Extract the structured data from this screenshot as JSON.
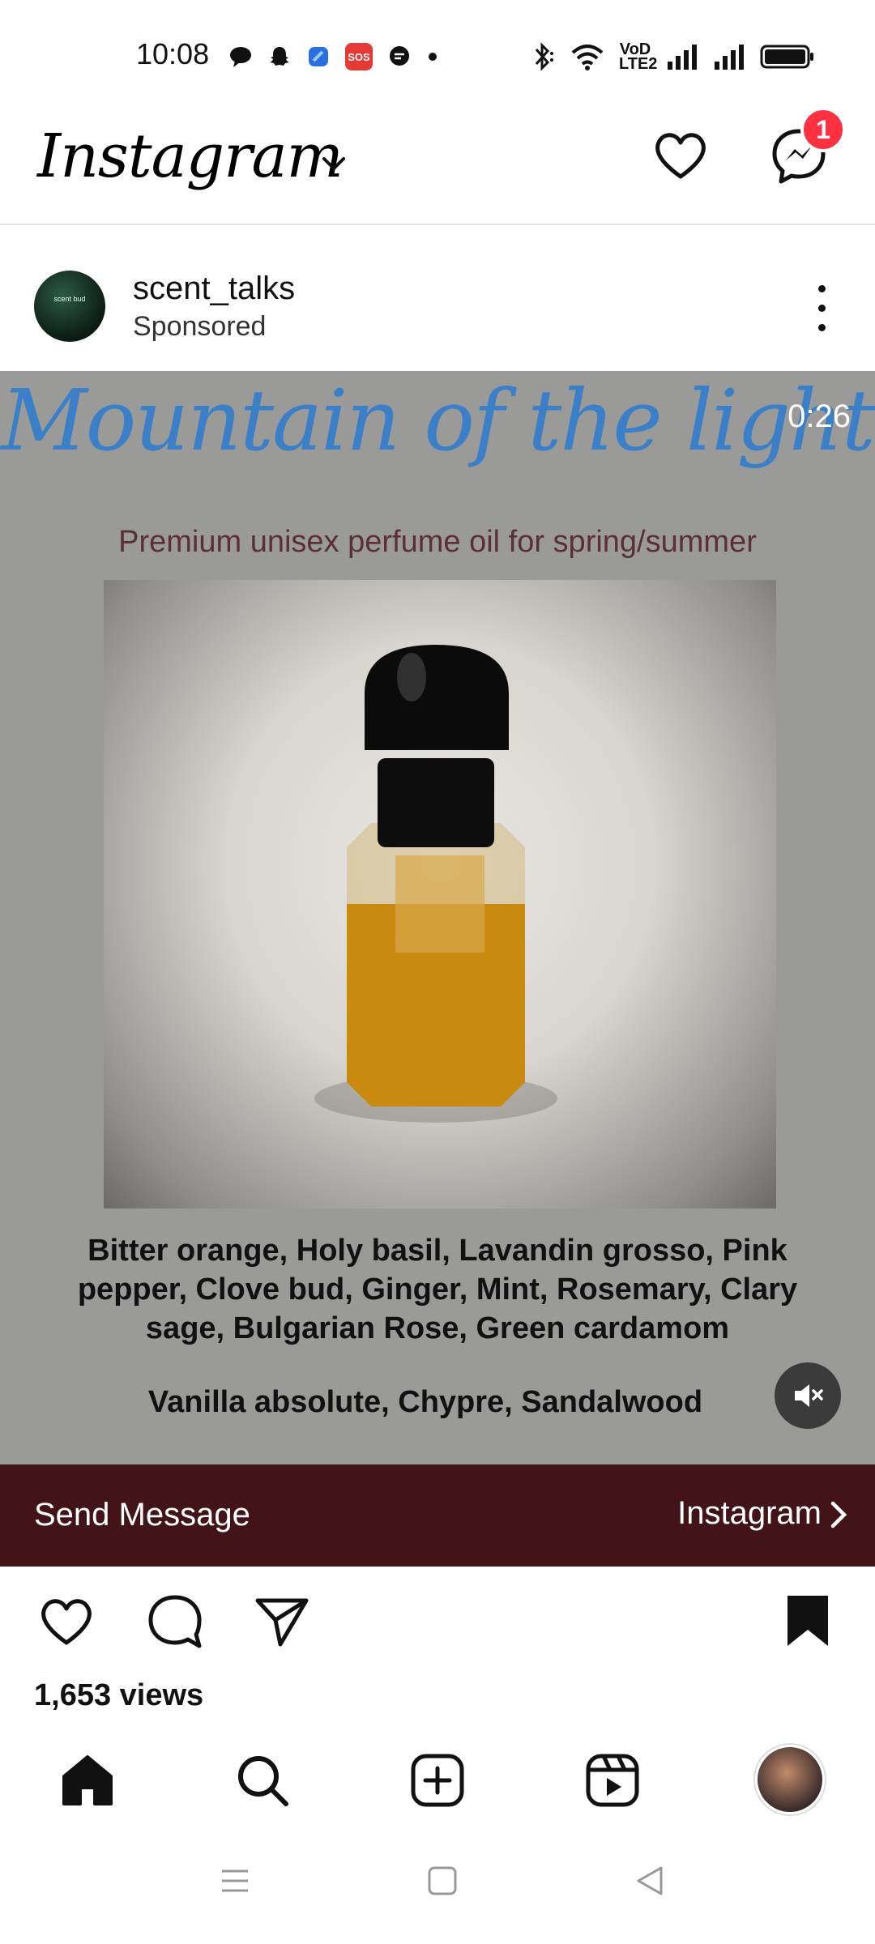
{
  "status_bar": {
    "time": "10:08",
    "sos_label": "SOS",
    "volte_label": "VoD LTE2"
  },
  "header": {
    "app_name": "Instagram",
    "messages_badge": "1"
  },
  "post": {
    "username": "scent_talks",
    "subtitle": "Sponsored",
    "avatar_text": "scent bud",
    "media": {
      "title": "Mountain of the light",
      "duration": "0:26",
      "tagline": "Premium unisex perfume oil for spring/summer",
      "notes_primary": "Bitter orange, Holy basil, Lavandin grosso, Pink pepper, Clove bud, Ginger, Mint, Rosemary, Clary sage, Bulgarian Rose, Green cardamom",
      "notes_base": "Vanilla absolute, Chypre, Sandalwood"
    },
    "cta": {
      "label": "Send Message",
      "destination": "Instagram"
    },
    "views": "1,653 views"
  },
  "bottom_nav": {
    "items": [
      "home-icon",
      "search-icon",
      "add-icon",
      "reels-icon",
      "profile-avatar"
    ]
  },
  "colors": {
    "cta_bg": "#431417",
    "badge": "#ff3040",
    "title_blue": "#3a7fc8"
  }
}
